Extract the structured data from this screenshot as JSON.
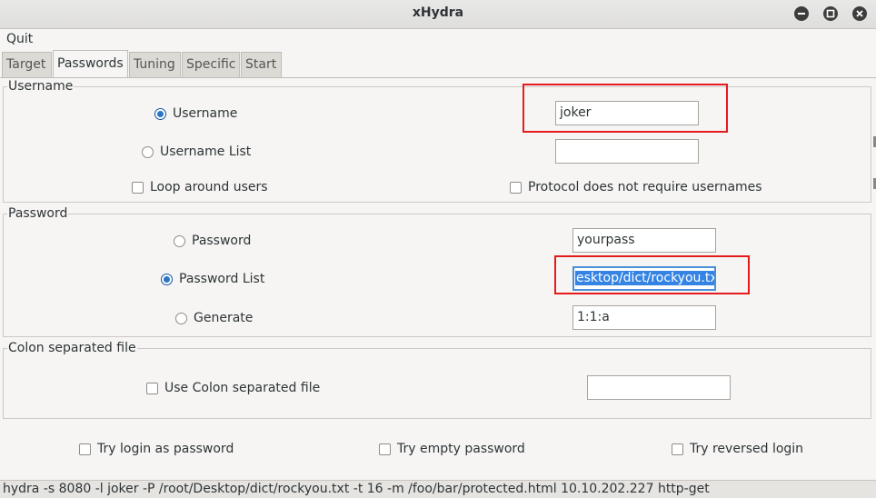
{
  "window": {
    "title": "xHydra"
  },
  "menu": {
    "quit": "Quit"
  },
  "tabs": [
    "Target",
    "Passwords",
    "Tuning",
    "Specific",
    "Start"
  ],
  "username_frame": {
    "legend": "Username",
    "username_option": "Username",
    "username_list_option": "Username List",
    "username_value": "joker",
    "username_list_value": "",
    "loop_users": "Loop around users",
    "no_usernames": "Protocol does not require usernames"
  },
  "password_frame": {
    "legend": "Password",
    "password_option": "Password",
    "password_list_option": "Password List",
    "generate_option": "Generate",
    "password_value": "yourpass",
    "password_list_value": "esktop/dict/rockyou.txt",
    "generate_value": "1:1:a"
  },
  "colon_frame": {
    "legend": "Colon separated file",
    "use_colon": "Use Colon separated file",
    "colon_value": ""
  },
  "extras": {
    "try_login": "Try login as password",
    "try_empty": "Try empty password",
    "try_reversed": "Try reversed login"
  },
  "status": {
    "command": "hydra -s 8080 -l joker -P /root/Desktop/dict/rockyou.txt -t 16 -m /foo/bar/protected.html 10.10.202.227 http-get"
  },
  "colors": {
    "highlight": "#e31b1b",
    "selection": "#3584e4"
  }
}
